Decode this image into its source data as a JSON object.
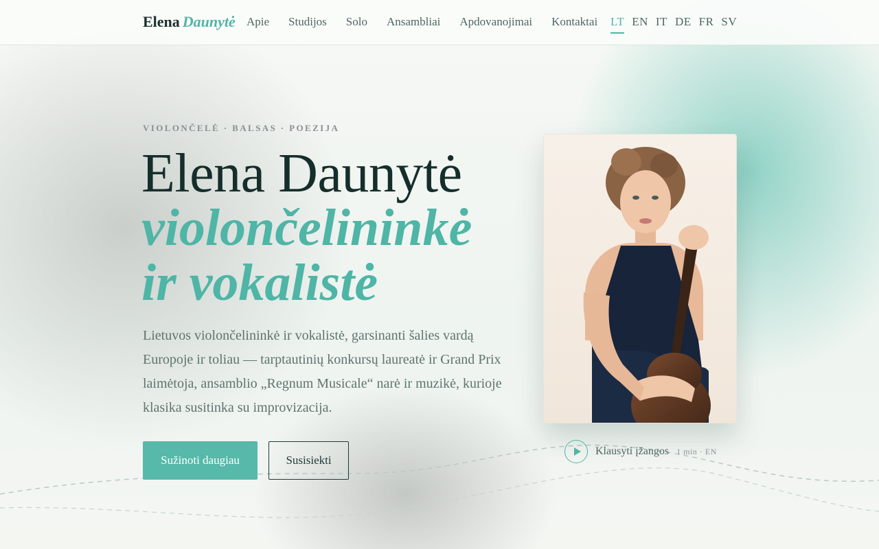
{
  "nav": {
    "brand_first": "Elena",
    "brand_last": "Daunytė",
    "links": [
      "Apie",
      "Studijos",
      "Solo",
      "Ansambliai",
      "Apdovanojimai",
      "Kontaktai"
    ],
    "languages": [
      "LT",
      "EN",
      "IT",
      "DE",
      "FR",
      "SV"
    ],
    "active_language": "LT"
  },
  "hero": {
    "kicker": "VIOLONČELĖ · BALSAS · POEZIJA",
    "title": "Elena Daunytė",
    "title_em_line1": "violončelininkė",
    "title_em_line2": "ir vokalistė",
    "lead": "Lietuvos violončelininkė ir vokalistė, garsinanti šalies vardą Europoje ir toliau — tarptautinių konkursų laureatė ir Grand Prix laimėtoja, ansamblio „Regnum Musicale“ narė ir muzikė, kurioje klasika susitinka su improvizacija.",
    "primary_button": "Sužinoti daugiau",
    "secondary_button": "Susisiekti"
  },
  "audio": {
    "label": "Klausyti įžangos",
    "meta": "1 min · EN"
  },
  "colors": {
    "accent": "#4fb5a6",
    "heading": "#162e2b",
    "text": "#5f7471"
  },
  "icons": {
    "play": "play-icon"
  }
}
